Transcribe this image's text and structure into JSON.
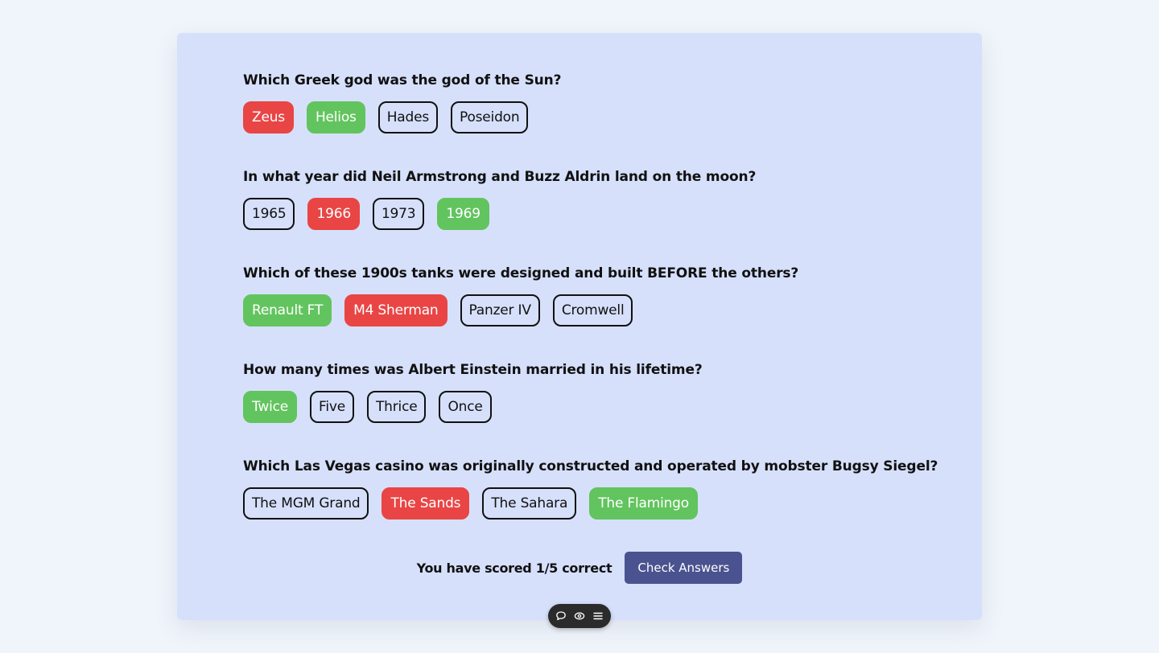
{
  "questions": [
    {
      "text": "Which Greek god was the god of the Sun?",
      "answers": [
        {
          "label": "Zeus",
          "state": "wrong"
        },
        {
          "label": "Helios",
          "state": "correct"
        },
        {
          "label": "Hades",
          "state": "neutral"
        },
        {
          "label": "Poseidon",
          "state": "neutral"
        }
      ]
    },
    {
      "text": "In what year did Neil Armstrong and Buzz Aldrin land on the moon?",
      "answers": [
        {
          "label": "1965",
          "state": "neutral"
        },
        {
          "label": "1966",
          "state": "wrong"
        },
        {
          "label": "1973",
          "state": "neutral"
        },
        {
          "label": "1969",
          "state": "correct"
        }
      ]
    },
    {
      "text": "Which of these 1900s tanks were designed and built BEFORE the others?",
      "answers": [
        {
          "label": "Renault FT",
          "state": "correct"
        },
        {
          "label": "M4 Sherman",
          "state": "wrong"
        },
        {
          "label": "Panzer IV",
          "state": "neutral"
        },
        {
          "label": "Cromwell",
          "state": "neutral"
        }
      ]
    },
    {
      "text": "How many times was Albert Einstein married in his lifetime?",
      "answers": [
        {
          "label": "Twice",
          "state": "correct"
        },
        {
          "label": "Five",
          "state": "neutral"
        },
        {
          "label": "Thrice",
          "state": "neutral"
        },
        {
          "label": "Once",
          "state": "neutral"
        }
      ]
    },
    {
      "text": "Which Las Vegas casino was originally constructed and operated by mobster Bugsy Siegel?",
      "answers": [
        {
          "label": "The MGM Grand",
          "state": "neutral"
        },
        {
          "label": "The Sands",
          "state": "wrong"
        },
        {
          "label": "The Sahara",
          "state": "neutral"
        },
        {
          "label": "The Flamingo",
          "state": "correct"
        }
      ]
    }
  ],
  "footer": {
    "score_text": "You have scored 1/5 correct",
    "check_label": "Check Answers"
  },
  "toolbar": {
    "icons": [
      "comment-icon",
      "eye-icon",
      "menu-icon"
    ]
  },
  "colors": {
    "page_background": "#f0f5fb",
    "card_background": "#d6e0fb",
    "correct": "#62c45e",
    "wrong": "#e94545",
    "button": "#4a538f",
    "toolbar": "#2b2b2b"
  }
}
